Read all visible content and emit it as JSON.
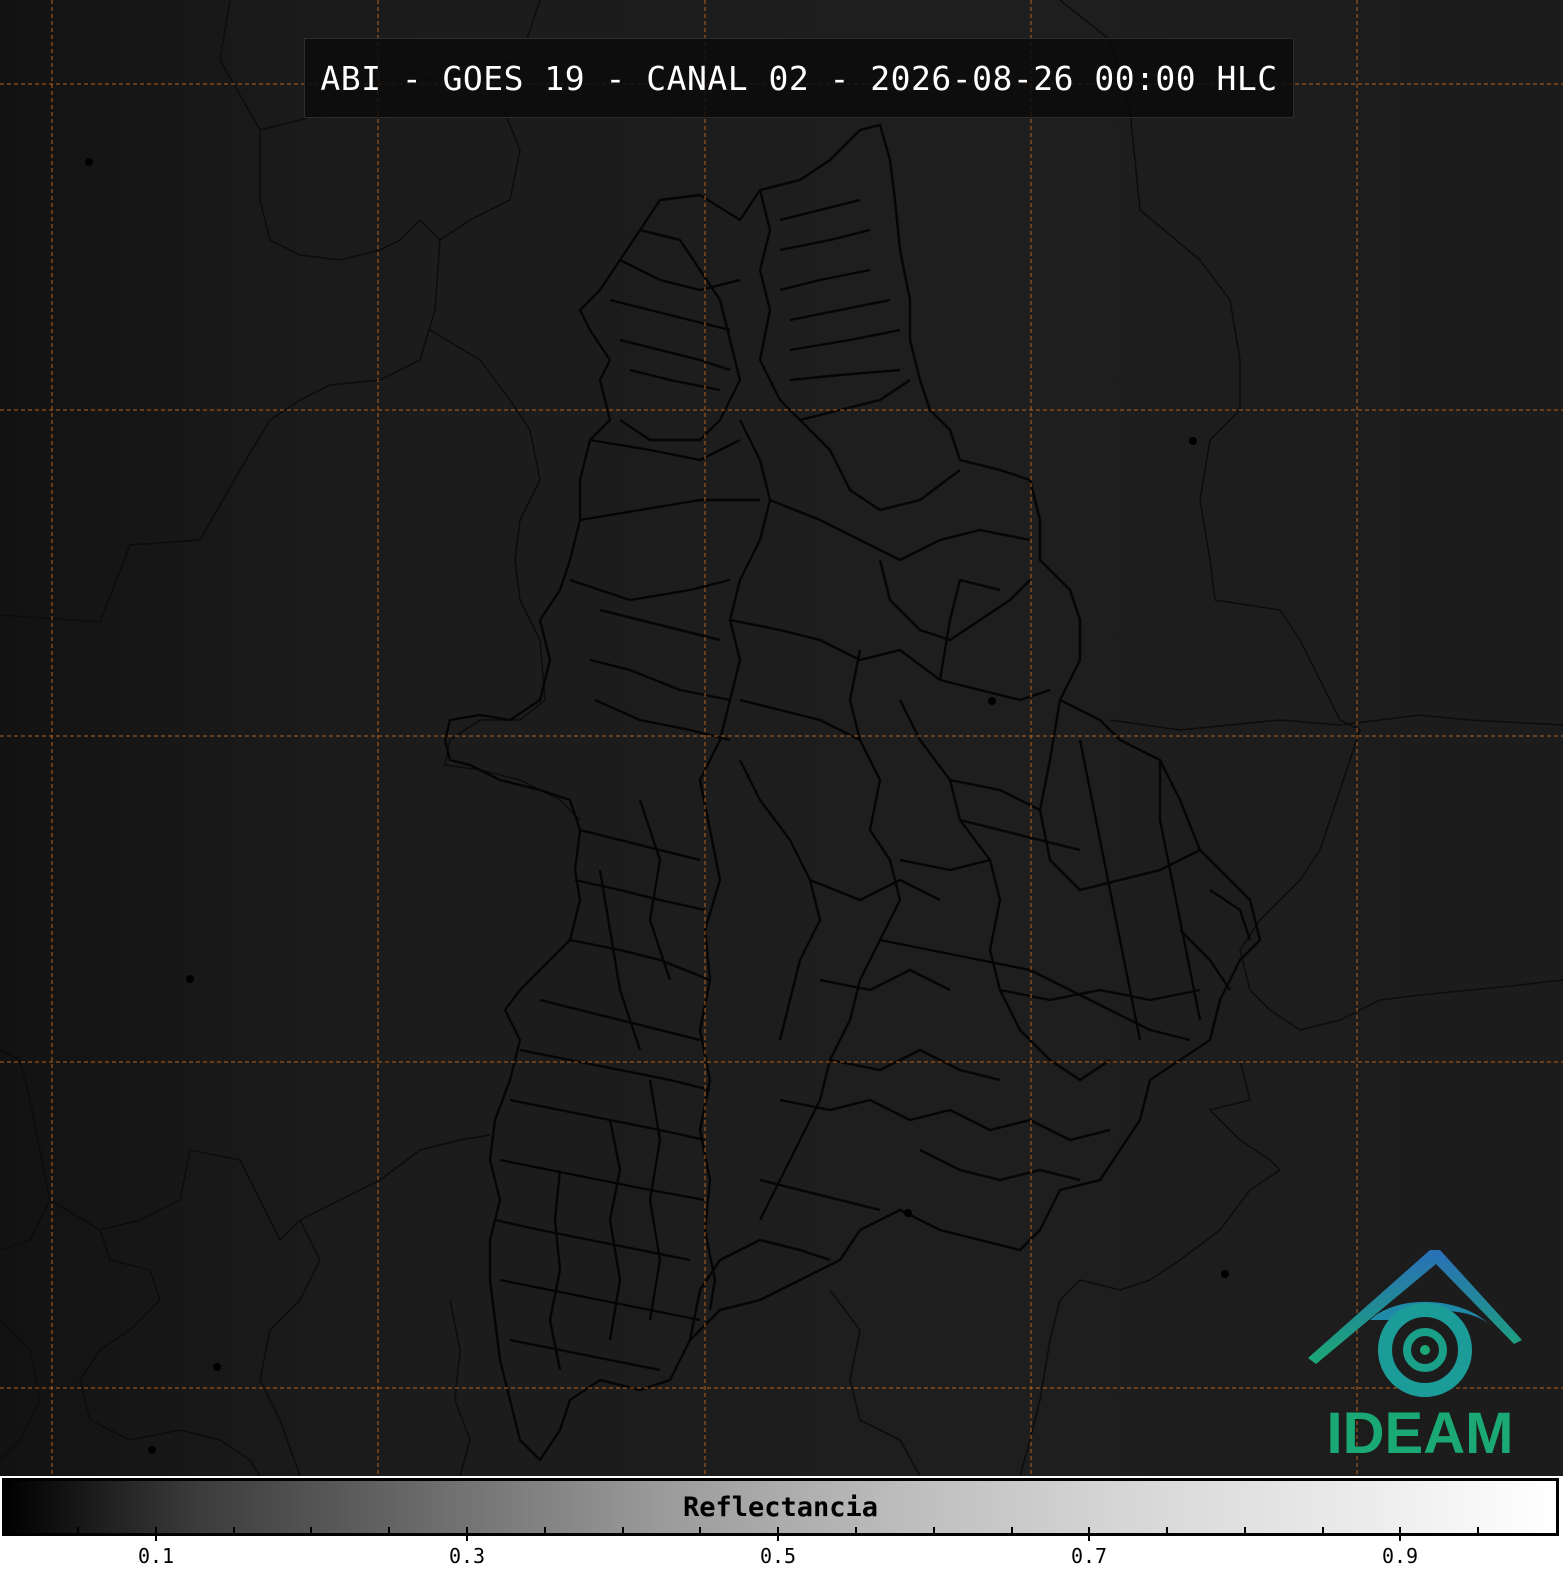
{
  "title": "ABI - GOES 19 - CANAL 02 - 2026-08-26 00:00 HLC",
  "logo": {
    "text": "IDEAM"
  },
  "colorbar": {
    "label": "Reflectancia",
    "ticks": [
      "0.1",
      "0.3",
      "0.5",
      "0.7",
      "0.9"
    ],
    "colormap": "grayscale black to white",
    "range": [
      0,
      1
    ]
  },
  "colors": {
    "background": "#1a1a1a",
    "gridlines": "#c96a1c",
    "borders": "#000000",
    "logo_blue": "#2a6fb8",
    "logo_green": "#1aa874"
  }
}
